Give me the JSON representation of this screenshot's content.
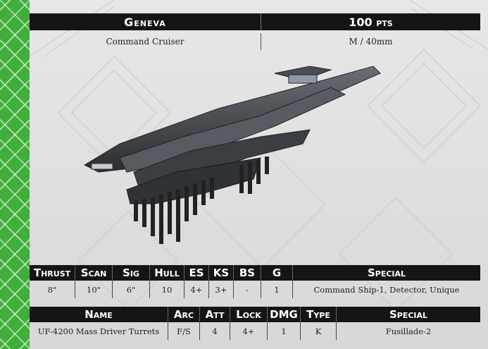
{
  "header": {
    "name": "Geneva",
    "points": "100 pts"
  },
  "subheader": {
    "ship_class": "Command Cruiser",
    "size": "M / 40mm"
  },
  "stats": {
    "headers": [
      "Thrust",
      "Scan",
      "Sig",
      "Hull",
      "ES",
      "KS",
      "BS",
      "G",
      "Special"
    ],
    "values": [
      "8\"",
      "10\"",
      "6\"",
      "10",
      "4+",
      "3+",
      "-",
      "1",
      "Command Ship-1, Detector, Unique"
    ]
  },
  "weapons": {
    "headers": [
      "Name",
      "Arc",
      "Att",
      "Lock",
      "DMG",
      "Type",
      "Special"
    ],
    "rows": [
      [
        "UF-4200 Mass Driver Turrets",
        "F/S",
        "4",
        "4+",
        "1",
        "K",
        "Fusillade-2"
      ]
    ]
  },
  "colors": {
    "stripe": "#3fae3a",
    "header_bg": "#151515",
    "panel_bg": "#dedede"
  }
}
